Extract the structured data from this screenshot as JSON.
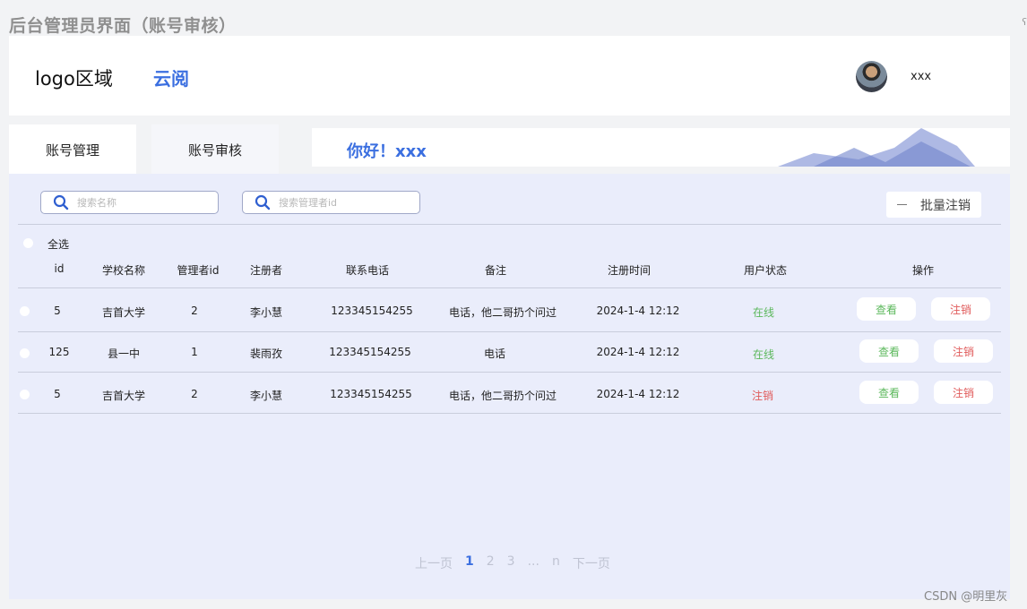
{
  "caption": "后台管理员界面（账号审核）",
  "edge_mark": "ʕ",
  "header": {
    "logo_text": "logo区域",
    "brand": "云阅",
    "avatar": "avatar-photo",
    "user_name": "xxx"
  },
  "tabs": [
    {
      "label": "账号管理",
      "active": false
    },
    {
      "label": "账号审核",
      "active": true
    }
  ],
  "banner": {
    "greeting": "你好！xxx"
  },
  "search": [
    {
      "placeholder": "搜索名称",
      "icon": "search-icon"
    },
    {
      "placeholder": "搜索管理者id",
      "icon": "search-icon"
    }
  ],
  "batch_button": {
    "label": "批量注销",
    "icon": "minus-icon"
  },
  "select_all_label": "全选",
  "table": {
    "columns": [
      "id",
      "学校名称",
      "管理者id",
      "注册者",
      "联系电话",
      "备注",
      "注册时间",
      "用户状态",
      "操作"
    ],
    "rows": [
      {
        "id": "5",
        "school": "吉首大学",
        "manager_id": "2",
        "registrant": "李小慧",
        "phone": "123345154255",
        "note": "电话，他二哥扔个问过",
        "time": "2024-1-4 12:12",
        "status": "在线",
        "status_color": "#5cb85c",
        "view": "查看",
        "cancel": "注销"
      },
      {
        "id": "125",
        "school": "县一中",
        "manager_id": "1",
        "registrant": "裴雨孜",
        "phone": "123345154255",
        "note": "电话",
        "time": "2024-1-4 12:12",
        "status": "在线",
        "status_color": "#5cb85c",
        "view": "查看",
        "cancel": "注销"
      },
      {
        "id": "5",
        "school": "吉首大学",
        "manager_id": "2",
        "registrant": "李小慧",
        "phone": "123345154255",
        "note": "电话，他二哥扔个问过",
        "time": "2024-1-4 12:12",
        "status": "注销",
        "status_color": "#e05a5a",
        "view": "查看",
        "cancel": "注销"
      }
    ]
  },
  "pagination": {
    "prev": "上一页",
    "pages": [
      "1",
      "2",
      "3",
      "...",
      "n"
    ],
    "current": "1",
    "next": "下一页"
  },
  "watermark": "CSDN @明里灰",
  "colors": {
    "accent": "#3b6fe0",
    "panel_bg": "#eaedfb",
    "online": "#5cb85c",
    "cancel": "#e05a5a"
  }
}
